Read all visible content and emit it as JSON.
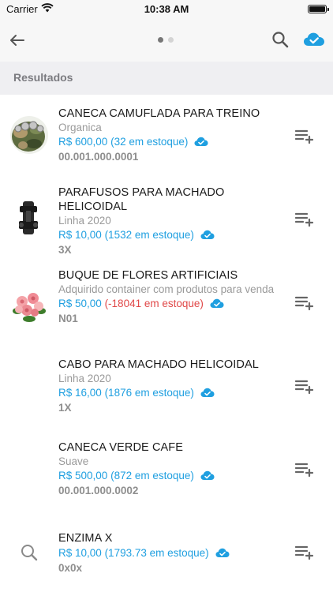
{
  "status_bar": {
    "carrier": "Carrier",
    "time": "10:38 AM"
  },
  "nav": {
    "back_icon": "arrow-left-icon",
    "search_icon": "search-icon",
    "sync_icon": "cloud-check-icon",
    "page_dots": 2,
    "active_page": 1
  },
  "section": {
    "title": "Resultados"
  },
  "colors": {
    "accent": "#1f9fe0",
    "negative": "#e04848",
    "header_bg": "#efeff2",
    "subtitle": "#9a9a9a"
  },
  "items": [
    {
      "name": "CANECA CAMUFLADA PARA TREINO",
      "subtitle": "Organica",
      "price": "R$ 600,00",
      "stock": "(32 em estoque)",
      "code": "00.001.000.0001"
    },
    {
      "name": "PARAFUSOS PARA MACHADO HELICOIDAL",
      "subtitle": "Linha 2020",
      "price": "R$ 10,00",
      "stock": "(1532 em estoque)",
      "code": "3X"
    },
    {
      "name": "BUQUE DE FLORES ARTIFICIAIS",
      "subtitle": "Adquirido container com produtos para venda",
      "price": "R$ 50,00",
      "stock": "(-18041 em estoque)",
      "code": "N01"
    },
    {
      "name": "CABO PARA MACHADO HELICOIDAL",
      "subtitle": "Linha 2020",
      "price": "R$ 16,00",
      "stock": "(1876 em estoque)",
      "code": "1X"
    },
    {
      "name": "CANECA VERDE CAFE",
      "subtitle": "Suave",
      "price": "R$ 500,00",
      "stock": "(872 em estoque)",
      "code": "00.001.000.0002"
    },
    {
      "name": "ENZIMA X",
      "subtitle": "",
      "price": "R$ 10,00",
      "stock": "(1793.73 em estoque)",
      "code": "0x0x"
    }
  ]
}
